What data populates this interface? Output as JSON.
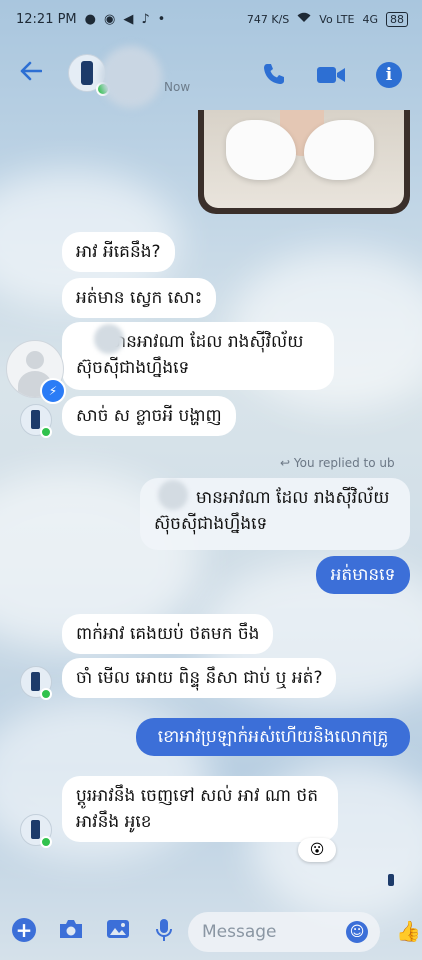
{
  "status_bar": {
    "time": "12:21 PM",
    "left_icons": [
      "●",
      "◉",
      "◀",
      "♪",
      "•"
    ],
    "right_text": [
      "747 K/S",
      "Vo LTE",
      "4G",
      "88"
    ]
  },
  "header": {
    "status": "Now",
    "icons": [
      "back-arrow-icon",
      "phone-icon",
      "video-camera-icon",
      "info-icon"
    ]
  },
  "messages_incoming": [
    {
      "text": "អាវ អីគេនឹង?"
    },
    {
      "text": "អត់មាន ស្វេក សោះ"
    },
    {
      "text_line1": "មានអាវណា ដែល រាងស៊ីវិល័យ",
      "text_line2": "ស៊ុចស៊ីជាងហ្នឹងទេ"
    },
    {
      "text": "សាច់ ស ខ្លាចអី បង្ហាញ"
    }
  ],
  "reply_label": "↩ You replied to ub",
  "replied_quote": {
    "line1": "មានអាវណា ដែល រាងស៊ីវិល័យ",
    "line2": "ស៊ុចស៊ីជាងហ្នឹងទេ"
  },
  "out_1": "អត់មានទេ",
  "messages_incoming_2": [
    {
      "text": "ពាក់អាវ គេងយប់ ថតមក ចឹង"
    },
    {
      "text": "ចាំ មើល អោយ ពិន្ទុ នឹសា ជាប់ ឬ អត់?"
    }
  ],
  "out_2": "ខោអាវប្រឡាក់អស់ហើយនិងលោកគ្រូ",
  "last_incoming": {
    "line1": "ប្តូរអាវនឹង ចេញទៅ សល់ អាវ ណា ថត",
    "line2": "អាវនឹង អូខេ"
  },
  "reaction": "😮",
  "composer": {
    "placeholder": "Message"
  },
  "colors": {
    "accent": "#3c6fd8",
    "online": "#31c24d",
    "bubble_in": "#ffffff"
  }
}
